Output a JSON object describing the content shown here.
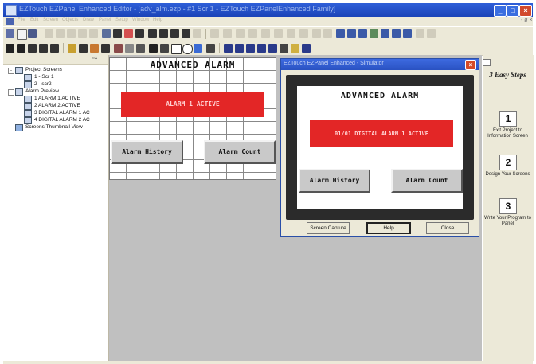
{
  "window": {
    "title": "EZTouch EZPanel Enhanced Editor - [adv_alm.ezp - #1 Scr 1 - EZTouch EZPanelEnhanced Family]"
  },
  "menu": {
    "items": [
      "File",
      "Edit",
      "Screen",
      "Objects",
      "Draw",
      "Panel",
      "Setup",
      "Window",
      "Help"
    ],
    "right_controls": "- ø ×"
  },
  "project_tree": {
    "root": "Project Screens",
    "screens": [
      "1 - Scr 1",
      "2 - scr2"
    ],
    "alarm_root": "Alarm Preview",
    "alarms": [
      "1 ALARM 1 ACTIVE",
      "2 ALARM 2 ACTIVE",
      "3 DIGITAL ALARM 1 AC",
      "4 DIGITAL ALARM 2 AC"
    ],
    "thumbnail": "Screens Thumbnail View",
    "expander_minus": "-"
  },
  "design_screen": {
    "title": "ADVANCED ALARM",
    "banner": "ALARM 1 ACTIVE",
    "history_button": "Alarm History",
    "count_button": "Alarm Count"
  },
  "simulator": {
    "title": "EZTouch EZPanel Enhanced - Simulator",
    "close_glyph": "×",
    "screen_title": "ADVANCED ALARM",
    "banner": "01/01 DIGITAL ALARM 1 ACTIVE",
    "history_button": "Alarm History",
    "count_button": "Alarm Count",
    "capture_button": "Screen Capture",
    "help_button": "Help",
    "close_button": "Close"
  },
  "steps_panel": {
    "title": "3 Easy Steps",
    "steps": [
      {
        "number": "1",
        "text": "Exit Project to Information Screen"
      },
      {
        "number": "2",
        "text": "Design Your Screens"
      },
      {
        "number": "3",
        "text": "Write Your Program to Panel"
      }
    ]
  },
  "colors": {
    "alarm_red": "#e32626",
    "title_blue": "#2a52c2",
    "canvas_grey": "#c0c0c0"
  }
}
